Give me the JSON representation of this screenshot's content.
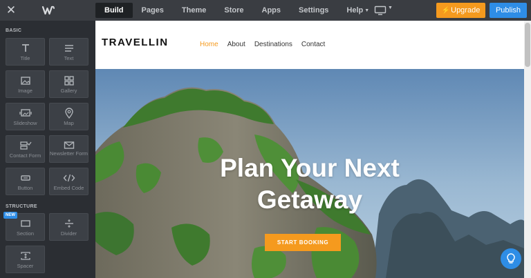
{
  "topbar": {
    "nav": [
      "Build",
      "Pages",
      "Theme",
      "Store",
      "Apps",
      "Settings",
      "Help"
    ],
    "active_nav": "Build",
    "upgrade_label": "Upgrade",
    "publish_label": "Publish"
  },
  "sidebar": {
    "basic_label": "BASIC",
    "basic_items": [
      "Title",
      "Text",
      "Image",
      "Gallery",
      "Slideshow",
      "Map",
      "Contact Form",
      "Newsletter Form",
      "Button",
      "Embed Code"
    ],
    "structure_label": "STRUCTURE",
    "new_badge": "NEW",
    "structure_items": [
      "Section",
      "Divider",
      "Spacer"
    ]
  },
  "site": {
    "logo": "TRAVELLIN",
    "nav": [
      "Home",
      "About",
      "Destinations",
      "Contact"
    ],
    "active_nav": "Home",
    "hero_line1": "Plan Your Next",
    "hero_line2": "Getaway",
    "cta": "START BOOKING"
  },
  "colors": {
    "accent_orange": "#f59a1e",
    "accent_blue": "#2e8de6",
    "topbar": "#3a3d42",
    "sidebar": "#2b2e33"
  }
}
